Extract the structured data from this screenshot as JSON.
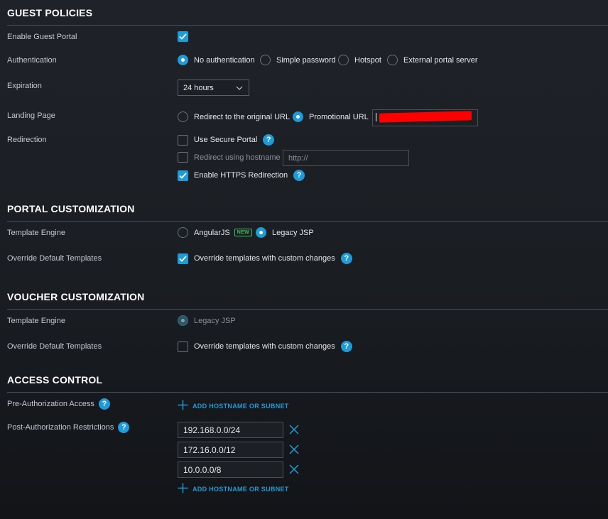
{
  "guest_policies": {
    "title": "GUEST POLICIES",
    "enable_portal_label": "Enable Guest Portal",
    "authentication_label": "Authentication",
    "auth_options": [
      "No authentication",
      "Simple password",
      "Hotspot",
      "External portal server"
    ],
    "auth_selected": "No authentication",
    "expiration_label": "Expiration",
    "expiration_value": "24 hours",
    "landing_label": "Landing Page",
    "landing_options": [
      "Redirect to the original URL",
      "Promotional URL"
    ],
    "landing_selected": "Promotional URL",
    "redirection_label": "Redirection",
    "use_secure_portal": "Use Secure Portal",
    "redirect_hostname": "Redirect using hostname",
    "hostname_placeholder": "http://",
    "https_redirection": "Enable HTTPS Redirection"
  },
  "portal_customization": {
    "title": "PORTAL CUSTOMIZATION",
    "template_engine_label": "Template Engine",
    "engine_angular": "AngularJS",
    "new_badge": "NEW",
    "engine_legacy": "Legacy JSP",
    "engine_selected": "Legacy JSP",
    "override_label": "Override Default Templates",
    "override_text": "Override templates with custom changes"
  },
  "voucher_customization": {
    "title": "VOUCHER CUSTOMIZATION",
    "template_engine_label": "Template Engine",
    "engine_legacy": "Legacy JSP",
    "override_label": "Override Default Templates",
    "override_text": "Override templates with custom changes"
  },
  "access_control": {
    "title": "ACCESS CONTROL",
    "pre_auth_label": "Pre-Authorization Access",
    "add_hostname": "ADD HOSTNAME OR SUBNET",
    "post_auth_label": "Post-Authorization Restrictions",
    "restrictions": [
      "192.168.0.0/24",
      "172.16.0.0/12",
      "10.0.0.0/8"
    ]
  },
  "colors": {
    "accent": "#1f9bd7",
    "badge_green": "#3fbf5f",
    "redaction": "#ff0000"
  },
  "icons": {
    "help": "question-mark-circle-icon",
    "check": "checkmark-icon",
    "chevron": "chevron-down-icon",
    "plus": "plus-icon",
    "delete": "x-close-icon"
  }
}
